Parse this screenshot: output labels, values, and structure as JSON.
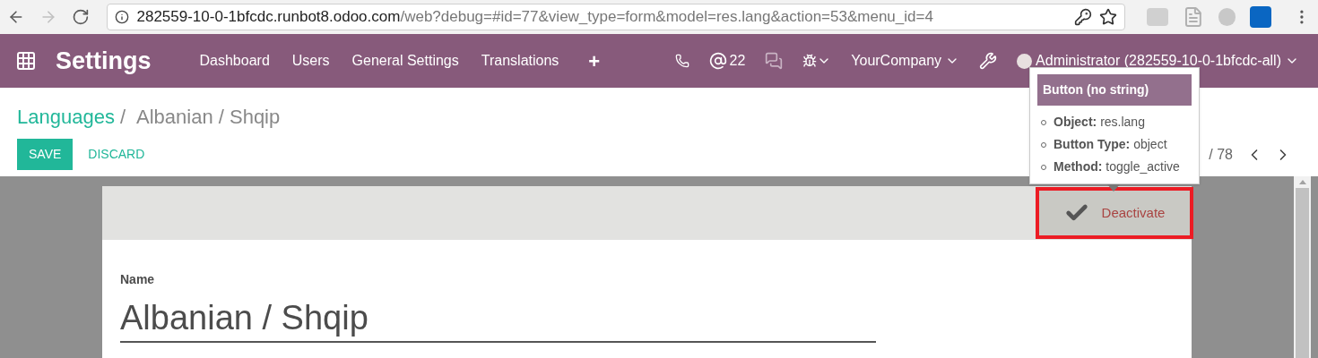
{
  "browser": {
    "url_host": "282559-10-0-1bfcdc.runbot8.odoo.com",
    "url_path": "/web?debug=#id=77&view_type=form&model=res.lang&action=53&menu_id=4"
  },
  "navbar": {
    "app_title": "Settings",
    "menu": [
      "Dashboard",
      "Users",
      "General Settings",
      "Translations",
      "+"
    ],
    "mentions_count": "22",
    "company": "YourCompany",
    "user": "Administrator (282559-10-0-1bfcdc-all)"
  },
  "breadcrumb": {
    "parent": "Languages",
    "separator": "/",
    "current": "Albanian / Shqip"
  },
  "buttons": [
    "SAVE",
    "DISCARD"
  ],
  "pager": "/ 78",
  "tooltip": {
    "title": "Button (no string)",
    "items": [
      {
        "label": "Object:",
        "value": "res.lang"
      },
      {
        "label": "Button Type:",
        "value": "object"
      },
      {
        "label": "Method:",
        "value": "toggle_active"
      }
    ]
  },
  "status_button": {
    "label": "Deactivate",
    "highlighted": true
  },
  "field": {
    "label": "Name",
    "value": "Albanian / Shqip"
  }
}
